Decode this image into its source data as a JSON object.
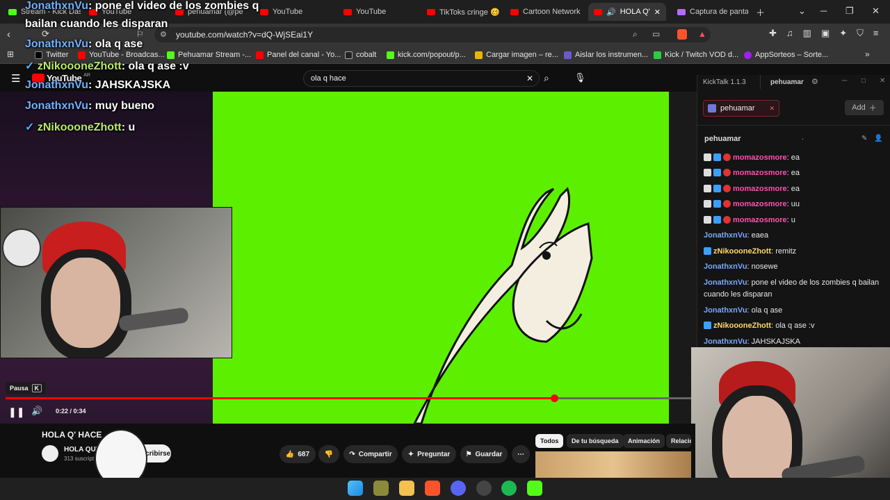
{
  "tabs": [
    {
      "label": "Stream - Kick Dash"
    },
    {
      "label": "YouTube"
    },
    {
      "label": "pehuamar (@pe"
    },
    {
      "label": "YouTube"
    },
    {
      "label": "YouTube"
    },
    {
      "label": "TikToks cringe 🥴"
    },
    {
      "label": "Cartoon Network"
    },
    {
      "label": "HOLA Q'"
    },
    {
      "label": "Captura de panta"
    }
  ],
  "address": {
    "url": "youtube.com/watch?v=dQ-WjSEai1Y"
  },
  "bookmarks": [
    "Twitter",
    "YouTube - Broadcas...",
    "Pehuamar Stream -...",
    "Panel del canal - Yo...",
    "cobalt",
    "kick.com/popout/p...",
    "Cargar imagen – re...",
    "Aislar los instrumen...",
    "Kick / Twitch VOD d...",
    "AppSorteos – Sorte..."
  ],
  "youtube": {
    "logo": "YouTube",
    "logo_sup": "AR",
    "search_value": "ola q hace",
    "pause_tooltip": "Pausa",
    "pause_key": "K",
    "time": "0:22 / 0:34",
    "progress": 0.8,
    "video_title": "HOLA Q' HACE",
    "channel_name": "HOLA QUE H",
    "subscribers": "313 suscript",
    "subscribe": "Suscribirse",
    "likes": "687",
    "share": "Compartir",
    "ask": "Preguntar",
    "save": "Guardar",
    "chips": [
      "Todos",
      "De tu búsqueda",
      "Animación",
      "Relacio"
    ]
  },
  "overlay_chat": [
    {
      "user": "JonathxnVu",
      "text": ": pone el video de los zombies q"
    },
    {
      "user": "",
      "text": "bailan cuando les disparan"
    },
    {
      "user": "JonathxnVu",
      "text": ": ola q ase"
    },
    {
      "user": "zNikoooneZhott",
      "text": ": ola q ase :v"
    },
    {
      "user": "JonathxnVu",
      "text": ": JAHSKAJSKA"
    },
    {
      "user": "JonathxnVu",
      "text": ": muy bueno"
    },
    {
      "user": "zNikoooneZhott",
      "text": ": u"
    }
  ],
  "kicktalk": {
    "title": "KickTalk 1.1.3",
    "account": "pehuamar",
    "tab": "pehuamar",
    "add": "Add",
    "channel": "pehuamar",
    "dot": ".",
    "messages": [
      {
        "user": "momazosmore",
        "text": ": ea"
      },
      {
        "user": "momazosmore",
        "text": ": ea"
      },
      {
        "user": "momazosmore",
        "text": ": ea"
      },
      {
        "user": "momazosmore",
        "text": ": uu"
      },
      {
        "user": "momazosmore",
        "text": ": u"
      },
      {
        "user": "JonathxnVu",
        "text": ": eaea"
      },
      {
        "user": "zNikoooneZhott",
        "text": ": remitz"
      },
      {
        "user": "JonathxnVu",
        "text": ": nosewe"
      },
      {
        "user": "JonathxnVu",
        "text": ": pone el video de los zombies q bailan cuando les disparan"
      },
      {
        "user": "JonathxnVu",
        "text": ": ola q ase"
      },
      {
        "user": "zNikoooneZhott",
        "text": ": ola q ase :v"
      },
      {
        "user": "JonathxnVu",
        "text": ": JAHSKAJSKA"
      }
    ]
  }
}
